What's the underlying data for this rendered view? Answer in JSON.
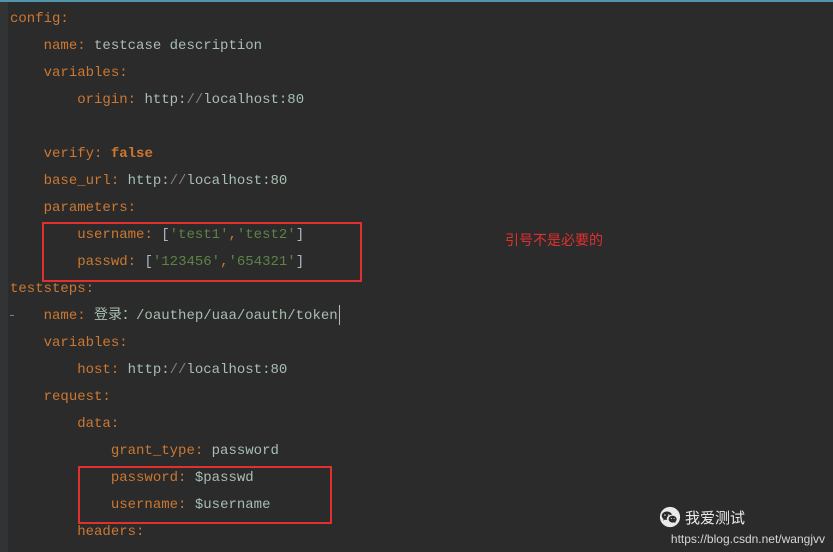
{
  "code": {
    "config_key": "config",
    "colon": ":",
    "name_key": "name",
    "name_value": "testcase description",
    "variables_key": "variables",
    "origin_key": "origin",
    "url_proto": "http:",
    "url_slashes": "//",
    "url_hostport": "localhost:80",
    "verify_key": "verify",
    "verify_value": "false",
    "base_url_key": "base_url",
    "parameters_key": "parameters",
    "username_key": "username",
    "bracket_open": "[",
    "bracket_close": "]",
    "test1": "'test1'",
    "test2": "'test2'",
    "comma": ",",
    "passwd_key": "passwd",
    "pw1": "'123456'",
    "pw2": "'654321'",
    "teststeps_key": "teststeps",
    "step_name_key": "name",
    "step_name_cjk": "登录：",
    "step_name_path": "/oauthep/uaa/oauth/token",
    "step_variables_key": "variables",
    "host_key": "host",
    "request_key": "request",
    "data_key": "data",
    "grant_type_key": "grant_type",
    "grant_type_value": "password",
    "password_key": "password",
    "password_value": "$passwd",
    "username2_key": "username",
    "username2_value": "$username",
    "headers_key": "headers",
    "fold_minus": "-"
  },
  "annotation": {
    "text": "引号不是必要的"
  },
  "watermarks": {
    "wechat_label": "我爱测试",
    "url": "https://blog.csdn.net/wangjvv"
  }
}
